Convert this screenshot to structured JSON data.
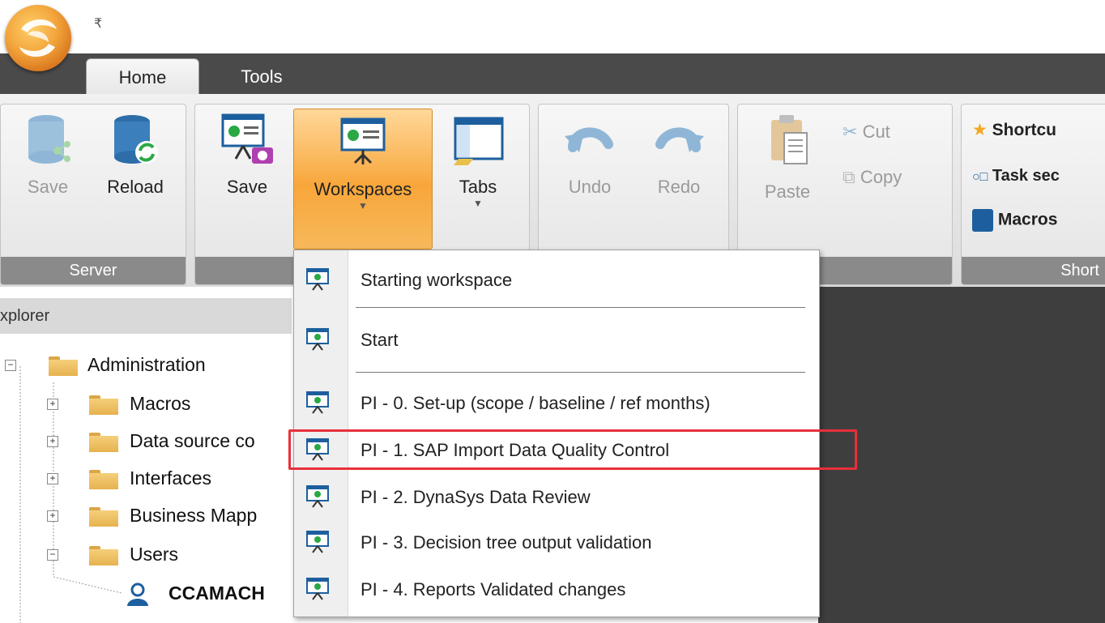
{
  "title_bar": {
    "qat_symbol": "₹"
  },
  "tabs": [
    {
      "label": "Home"
    },
    {
      "label": "Tools"
    }
  ],
  "ribbon": {
    "server": {
      "label": "Server",
      "save": "Save",
      "reload": "Reload"
    },
    "workspace": {
      "save": "Save",
      "workspaces": "Workspaces",
      "tabs": "Tabs",
      "arrow": "▼"
    },
    "edit": {
      "undo": "Undo",
      "redo": "Redo"
    },
    "clipboard": {
      "paste": "Paste",
      "cut": "Cut",
      "copy": "Copy"
    },
    "shortcuts": {
      "label": "Short",
      "shortcut": "Shortcu",
      "task": "Task sec",
      "macros": "Macros"
    }
  },
  "explorer": {
    "header": "xplorer",
    "tree": [
      {
        "label": "Administration",
        "expander": "−"
      },
      {
        "label": "Macros",
        "expander": "+"
      },
      {
        "label": "Data source co",
        "expander": "+"
      },
      {
        "label": "Interfaces",
        "expander": "+"
      },
      {
        "label": "Business Mapp",
        "expander": "+"
      },
      {
        "label": "Users",
        "expander": "−"
      },
      {
        "label": "CCAMACH"
      }
    ]
  },
  "workspaces_menu": {
    "items": [
      {
        "label": "Starting workspace"
      },
      {
        "label": "Start"
      },
      {
        "label": "PI - 0. Set-up (scope / baseline / ref months)"
      },
      {
        "label": "PI - 1. SAP Import Data Quality Control"
      },
      {
        "label": "PI - 2. DynaSys Data Review"
      },
      {
        "label": "PI - 3. Decision tree output validation"
      },
      {
        "label": "PI - 4. Reports  Validated changes"
      }
    ]
  }
}
